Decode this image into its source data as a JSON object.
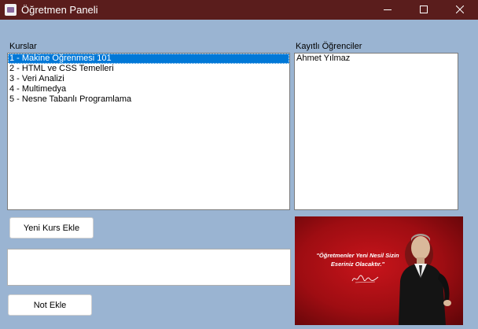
{
  "window": {
    "title": "Öğretmen Paneli"
  },
  "courses": {
    "label": "Kurslar",
    "items": [
      "1 - Makine Öğrenmesi 101",
      "2 - HTML ve CSS Temelleri",
      "3 - Veri Analizi",
      "4 - Multimedya",
      "5 - Nesne Tabanlı Programlama"
    ],
    "selected_index": 0
  },
  "students": {
    "label": "Kayıtlı Öğrenciler",
    "items": [
      "Ahmet Yılmaz"
    ]
  },
  "buttons": {
    "add_course": "Yeni Kurs Ekle",
    "add_note": "Not Ekle"
  },
  "note_input": {
    "value": ""
  },
  "picture": {
    "quote_line1": "\"Öğretmenler Yeni Nesil Sizin",
    "quote_line2": "Eseriniz Olacaktır.\""
  },
  "colors": {
    "titlebar": "#5a1d1c",
    "background": "#9ab4d2",
    "selection": "#0078d7",
    "poster_red": "#c8141b"
  }
}
